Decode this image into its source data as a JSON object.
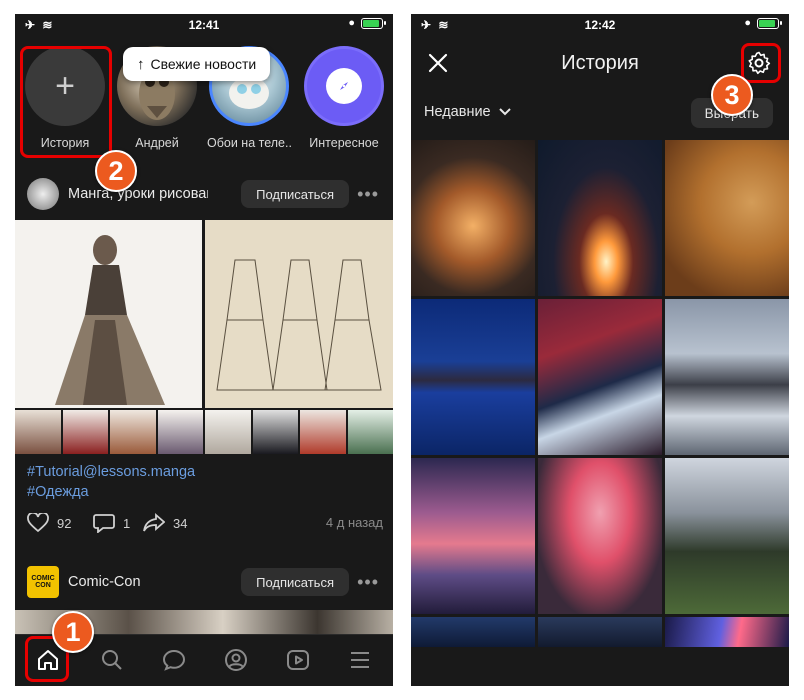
{
  "left_screen": {
    "status_bar": {
      "time": "12:41"
    },
    "stories": [
      {
        "label": "История"
      },
      {
        "label": "Андрей"
      },
      {
        "label": "Обои на теле..."
      },
      {
        "label": "Интересное"
      }
    ],
    "news_pill": {
      "label": "Свежие новости"
    },
    "post1": {
      "title": "Манга, уроки рисования",
      "subscribe_label": "Подписаться",
      "tags": [
        "#Tutorial@lessons.manga",
        "#Одежда"
      ],
      "likes": "92",
      "comments": "1",
      "shares": "34",
      "time": "4 д назад"
    },
    "post2": {
      "title": "Comic-Con",
      "subscribe_label": "Подписаться"
    },
    "bottom_nav": [
      "home-icon",
      "search-icon",
      "messages-icon",
      "profile-icon",
      "video-icon",
      "menu-icon"
    ]
  },
  "right_screen": {
    "status_bar": {
      "time": "12:42"
    },
    "title": "История",
    "filter_label": "Недавние",
    "choose_label": "Выбрать"
  },
  "annotations": {
    "badge_1": "1",
    "badge_2": "2",
    "badge_3": "3",
    "highlight_color": "#e60000",
    "badge_color": "#ec5a1f"
  },
  "colors": {
    "background": "#191919",
    "link": "#6b9ddf",
    "accent_purple": "#6c5cf5"
  }
}
